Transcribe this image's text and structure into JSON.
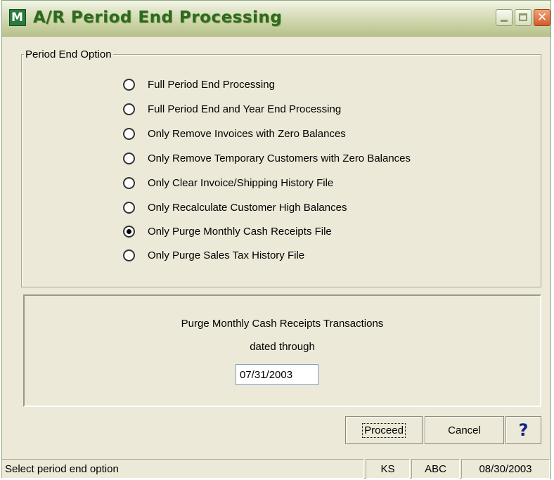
{
  "window": {
    "title": "A/R Period End Processing",
    "app_icon": "mas90-app-icon",
    "controls": [
      "minimize",
      "maximize",
      "close"
    ]
  },
  "group": {
    "legend": "Period End Option",
    "options": [
      {
        "label": "Full Period End Processing",
        "selected": false
      },
      {
        "label": "Full Period End and Year End Processing",
        "selected": false
      },
      {
        "label": "Only Remove Invoices with Zero Balances",
        "selected": false
      },
      {
        "label": "Only Remove Temporary Customers with Zero Balances",
        "selected": false
      },
      {
        "label": "Only Clear Invoice/Shipping History File",
        "selected": false
      },
      {
        "label": "Only Recalculate Customer High Balances",
        "selected": false
      },
      {
        "label": "Only Purge Monthly Cash Receipts File",
        "selected": true
      },
      {
        "label": "Only Purge Sales Tax History File",
        "selected": false
      }
    ]
  },
  "detail": {
    "line1": "Purge Monthly Cash Receipts Transactions",
    "line2": "dated through",
    "date_value": "07/31/2003"
  },
  "buttons": {
    "proceed": "Proceed",
    "cancel": "Cancel",
    "help": "?"
  },
  "statusbar": {
    "message": "Select period end option",
    "user": "KS",
    "company": "ABC",
    "date": "08/30/2003"
  },
  "colors": {
    "title_text": "#2c6a20",
    "dialog_bg": "#ece9d8",
    "help_icon": "#13248b"
  }
}
